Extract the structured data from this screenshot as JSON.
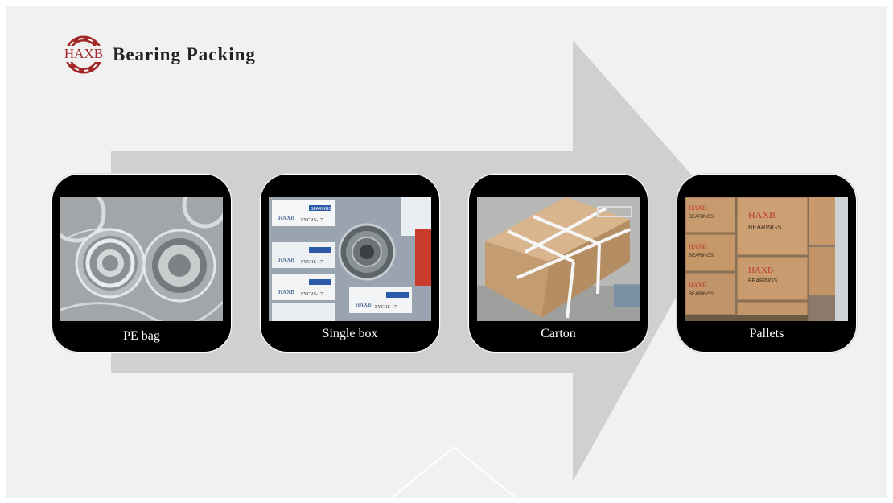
{
  "header": {
    "logo_text": "HAXB",
    "title": "Bearing Packing"
  },
  "steps": [
    {
      "label": "PE bag",
      "photo_icon": "pe-bag-photo"
    },
    {
      "label": "Single box",
      "photo_icon": "single-box-photo",
      "box_text": "HAXB",
      "box_brand": "BEARINGS",
      "box_model": "FYCRS-17"
    },
    {
      "label": "Carton",
      "photo_icon": "carton-photo"
    },
    {
      "label": "Pallets",
      "photo_icon": "pallets-photo",
      "box_text": "HAXB",
      "box_brand": "BEARINGS"
    }
  ],
  "colors": {
    "background": "#f1f1f1",
    "arrow": "#d0d0d0",
    "card": "#000000",
    "logo": "#a22828",
    "carton": "#c8a27a"
  }
}
